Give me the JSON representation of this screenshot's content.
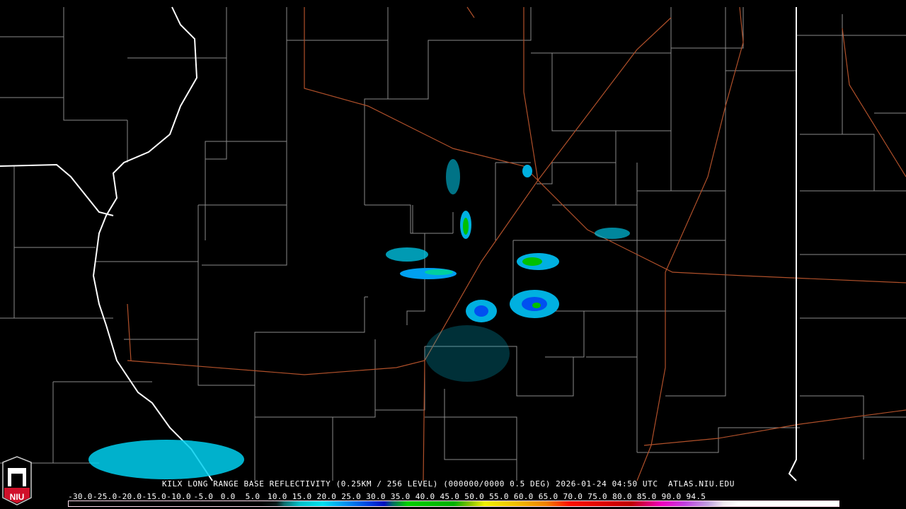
{
  "caption": "KILX LONG RANGE BASE REFLECTIVITY (0.25KM / 256 LEVEL) (000000/0000 0.5 DEG) 2026-01-24 04:50 UTC  ATLAS.NIU.EDU",
  "logo_text": "NIU",
  "scale_labels": [
    "-30.0",
    "-25.0",
    "-20.0",
    "-15.0",
    "-10.0",
    "-5.0",
    "0.0",
    "5.0",
    "10.0",
    "15.0",
    "20.0",
    "25.0",
    "30.0",
    "35.0",
    "40.0",
    "45.0",
    "50.0",
    "55.0",
    "60.0",
    "65.0",
    "70.0",
    "75.0",
    "80.0",
    "85.0",
    "90.0",
    "94.5"
  ],
  "colors": {
    "county": "#8a8a8a",
    "state": "#ffffff",
    "highway": "#b0502a",
    "echo_light": "#00c8e0",
    "echo_mid": "#0060f0",
    "echo_strong": "#00c000"
  }
}
